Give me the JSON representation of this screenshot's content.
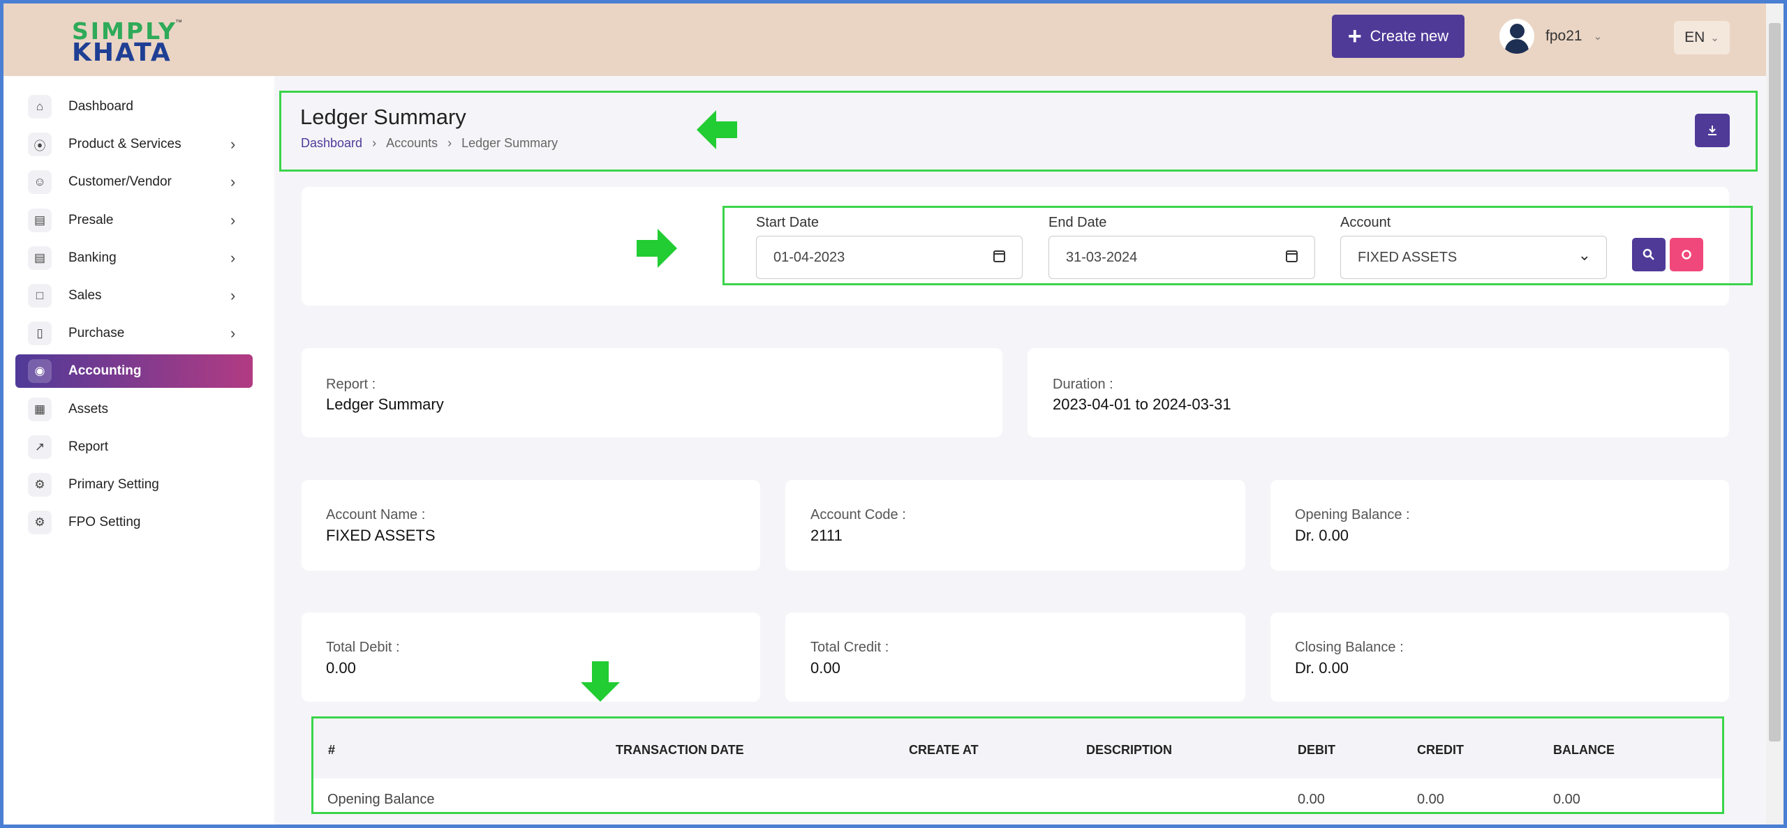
{
  "header": {
    "logo_line1": "SIMPLY",
    "logo_line2": "KHATA",
    "logo_tm": "™",
    "create_new_label": "Create new",
    "user_name": "fpo21",
    "language": "EN"
  },
  "sidebar": {
    "items": [
      {
        "label": "Dashboard",
        "icon": "home-icon",
        "has_arrow": false
      },
      {
        "label": "Product & Services",
        "icon": "cart-icon",
        "has_arrow": true
      },
      {
        "label": "Customer/Vendor",
        "icon": "user-plus-icon",
        "has_arrow": true
      },
      {
        "label": "Presale",
        "icon": "building-icon",
        "has_arrow": true
      },
      {
        "label": "Banking",
        "icon": "bank-icon",
        "has_arrow": true
      },
      {
        "label": "Sales",
        "icon": "document-icon",
        "has_arrow": true
      },
      {
        "label": "Purchase",
        "icon": "clipboard-icon",
        "has_arrow": true
      },
      {
        "label": "Accounting",
        "icon": "accounting-icon",
        "has_arrow": false,
        "active": true
      },
      {
        "label": "Assets",
        "icon": "calculator-icon",
        "has_arrow": false
      },
      {
        "label": "Report",
        "icon": "chart-icon",
        "has_arrow": false
      },
      {
        "label": "Primary Setting",
        "icon": "settings-icon",
        "has_arrow": false
      },
      {
        "label": "FPO Setting",
        "icon": "gear-icon",
        "has_arrow": false
      }
    ]
  },
  "page": {
    "title": "Ledger Summary",
    "breadcrumb": [
      "Dashboard",
      "Accounts",
      "Ledger Summary"
    ]
  },
  "filters": {
    "start_date_label": "Start Date",
    "start_date": "01-04-2023",
    "end_date_label": "End Date",
    "end_date": "31-03-2024",
    "account_label": "Account",
    "account": "FIXED ASSETS"
  },
  "summary": {
    "report_label": "Report :",
    "report_value": "Ledger Summary",
    "duration_label": "Duration :",
    "duration_value": "2023-04-01 to 2024-03-31",
    "account_name_label": "Account Name :",
    "account_name": "FIXED ASSETS",
    "account_code_label": "Account Code :",
    "account_code": "2111",
    "opening_balance_label": "Opening Balance :",
    "opening_balance": "Dr. 0.00",
    "total_debit_label": "Total Debit :",
    "total_debit": "0.00",
    "total_credit_label": "Total Credit :",
    "total_credit": "0.00",
    "closing_balance_label": "Closing Balance :",
    "closing_balance": "Dr. 0.00"
  },
  "table": {
    "columns": [
      "#",
      "TRANSACTION DATE",
      "CREATE AT",
      "DESCRIPTION",
      "DEBIT",
      "CREDIT",
      "BALANCE"
    ],
    "rows": [
      {
        "label": "Opening Balance",
        "debit": "0.00",
        "credit": "0.00",
        "balance": "0.00"
      }
    ]
  },
  "colors": {
    "brand": "#4f3a98",
    "header_bg": "#ead5c4",
    "highlight": "#3bd44b",
    "reset": "#f0487a"
  }
}
